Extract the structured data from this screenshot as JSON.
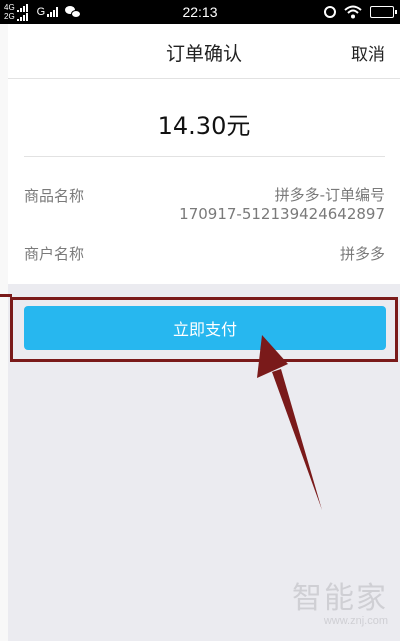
{
  "status_bar": {
    "network_top": "4G",
    "network_bottom": "2G",
    "network_g": "G",
    "time": "22:13"
  },
  "header": {
    "title": "订单确认",
    "cancel_label": "取消"
  },
  "order": {
    "amount": "14.30元",
    "rows": [
      {
        "label": "商品名称",
        "value_line1": "拼多多-订单编号",
        "value_line2": "170917-512139424642897"
      },
      {
        "label": "商户名称",
        "value_line1": "拼多多"
      }
    ]
  },
  "action": {
    "pay_label": "立即支付"
  },
  "watermark": {
    "brand": "智能家",
    "url": "www.znj.com"
  },
  "colors": {
    "pay_button": "#27b7ef",
    "highlight": "#7a1a1a"
  }
}
